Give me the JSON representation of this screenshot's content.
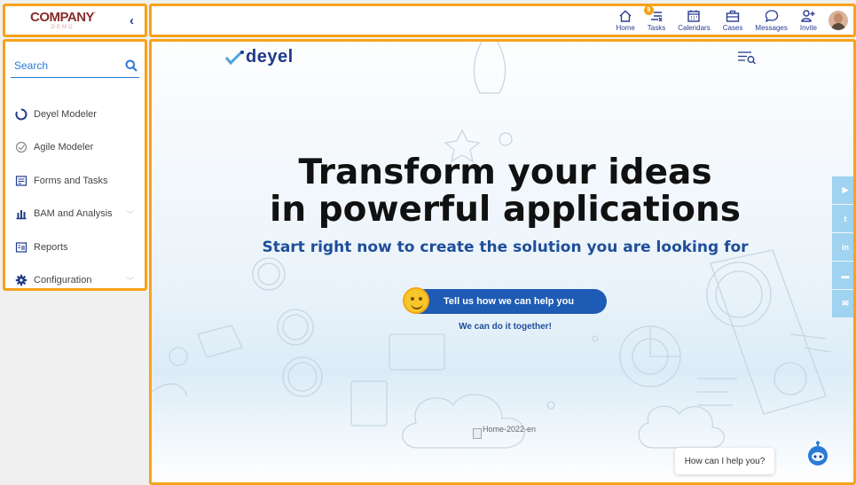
{
  "logo": {
    "text": "COMPANY",
    "sub": "DEMO"
  },
  "collapse_glyph": "‹",
  "topnav": {
    "items": [
      {
        "label": "Home",
        "icon": "home-icon"
      },
      {
        "label": "Tasks",
        "icon": "tasks-icon",
        "badge": "9"
      },
      {
        "label": "Calendars",
        "icon": "calendar-icon"
      },
      {
        "label": "Cases",
        "icon": "briefcase-icon"
      },
      {
        "label": "Messages",
        "icon": "chat-icon"
      },
      {
        "label": "Invite",
        "icon": "add-user-icon"
      }
    ]
  },
  "sidebar": {
    "search_placeholder": "Search",
    "items": [
      {
        "label": "Deyel Modeler",
        "icon": "circle-loader-icon",
        "has_children": false
      },
      {
        "label": "Agile Modeler",
        "icon": "agile-modeler-icon",
        "has_children": false
      },
      {
        "label": "Forms and Tasks",
        "icon": "form-icon",
        "has_children": false
      },
      {
        "label": "BAM and Analysis",
        "icon": "bar-chart-icon",
        "has_children": true
      },
      {
        "label": "Reports",
        "icon": "report-icon",
        "has_children": false
      },
      {
        "label": "Configuration",
        "icon": "gear-icon",
        "has_children": true
      }
    ]
  },
  "main": {
    "brand": "deyel",
    "headline_1": "Transform your ideas",
    "headline_2": "in powerful applications",
    "subheadline": "Start right now to create the solution you are looking for",
    "cta_label": "Tell us how we can help you",
    "cta_sub": "We can do it together!",
    "broken_image_alt": "Home-2022-en",
    "social": [
      "▶",
      "t",
      "in",
      "▬",
      "✉"
    ],
    "chat_prompt": "How can I help you?"
  },
  "colors": {
    "accent": "#f7a21b",
    "brand_blue": "#1f3a8a",
    "link_blue": "#2a7bd5",
    "cta": "#1e5bb4"
  }
}
